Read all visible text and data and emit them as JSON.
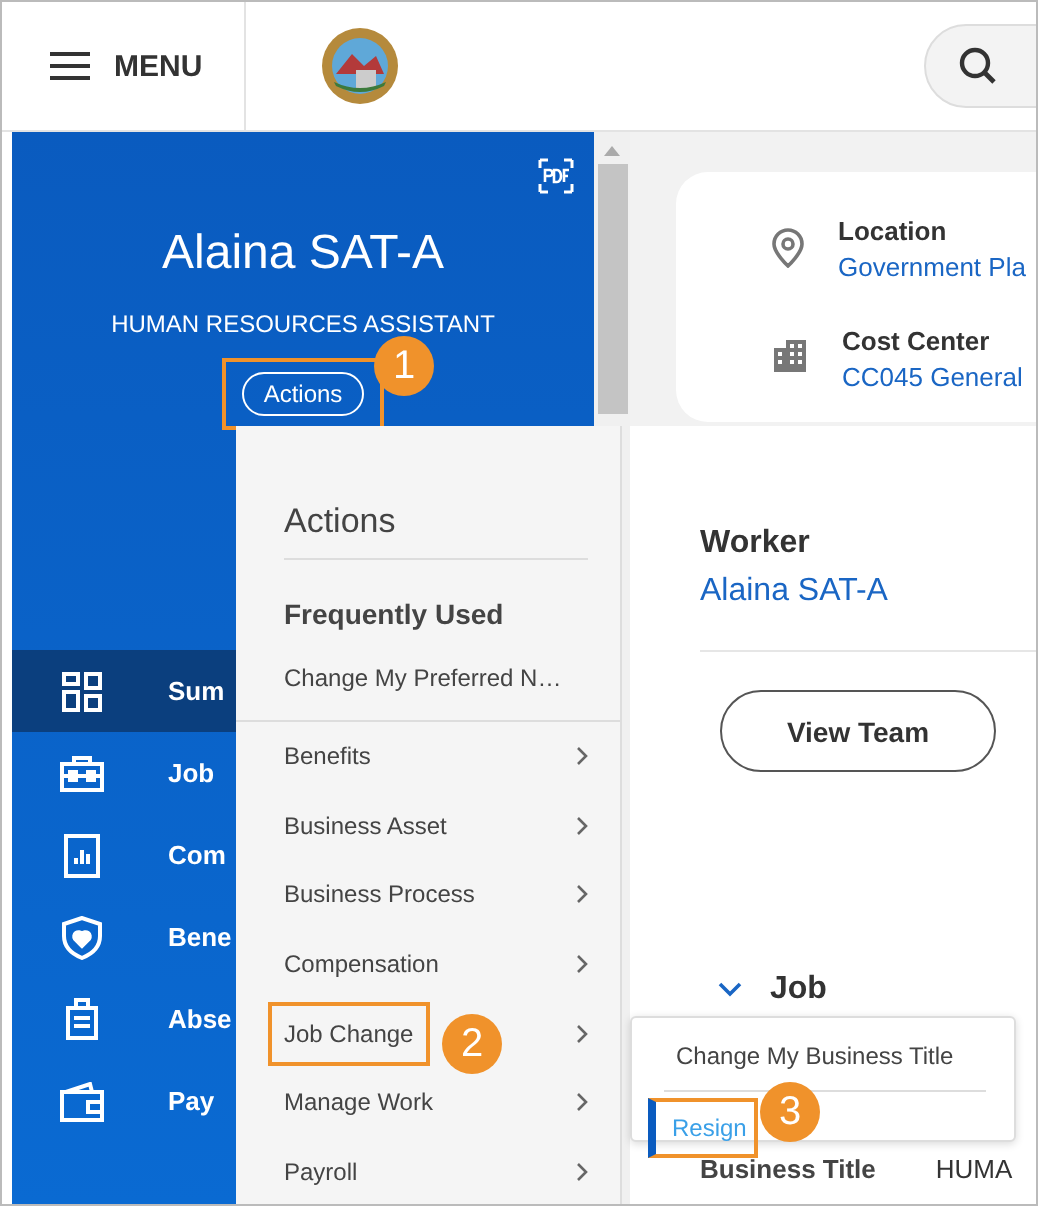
{
  "header": {
    "menu_label": "MENU"
  },
  "profile": {
    "name": "Alaina SAT-A",
    "title": "HUMAN RESOURCES ASSISTANT",
    "actions_button": {
      "label": "Actions",
      "highlighted": true
    }
  },
  "sidebar": {
    "items": [
      {
        "label": "Sum",
        "selected": true
      },
      {
        "label": "Job",
        "selected": false
      },
      {
        "label": "Com",
        "selected": false
      },
      {
        "label": "Bene",
        "selected": false
      },
      {
        "label": "Abse",
        "selected": false
      },
      {
        "label": "Pay",
        "selected": false
      }
    ]
  },
  "info_card": {
    "fields": [
      {
        "label": "Location",
        "value": "Government Pla"
      },
      {
        "label": "Cost Center",
        "value": "CC045 General"
      }
    ]
  },
  "worker": {
    "label": "Worker",
    "value": "Alaina SAT-A",
    "button": "View Team"
  },
  "job_section": {
    "title": "Job",
    "expanded": true,
    "field_label": "Business Title",
    "field_value": "HUMA"
  },
  "actions_menu": {
    "title": "Actions",
    "frequent_heading": "Frequently Used",
    "frequent_items": [
      "Change My Preferred N…"
    ],
    "categories": [
      {
        "label": "Benefits",
        "highlighted": false
      },
      {
        "label": "Business Asset",
        "highlighted": false
      },
      {
        "label": "Business Process",
        "highlighted": false
      },
      {
        "label": "Compensation",
        "highlighted": false
      },
      {
        "label": "Job Change",
        "highlighted": true
      },
      {
        "label": "Manage Work",
        "highlighted": false
      },
      {
        "label": "Payroll",
        "highlighted": false
      }
    ]
  },
  "submenu": {
    "items": [
      {
        "label": "Change My Business Title",
        "selected": false
      },
      {
        "label": "Resign",
        "selected": true
      }
    ]
  },
  "callouts": [
    "1",
    "2",
    "3"
  ]
}
